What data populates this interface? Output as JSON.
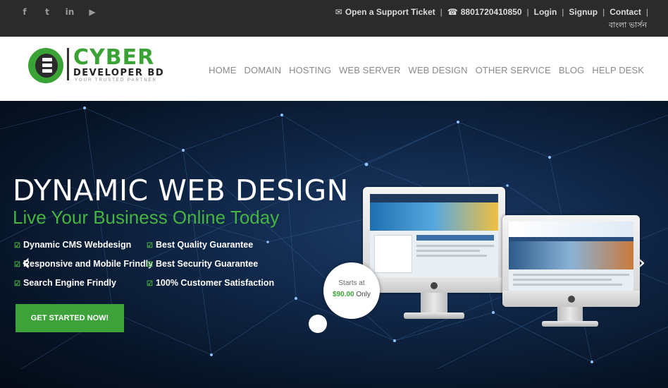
{
  "topbar": {
    "social": [
      {
        "icon": "facebook-icon",
        "glyph": "f"
      },
      {
        "icon": "twitter-icon",
        "glyph": "t"
      },
      {
        "icon": "linkedin-icon",
        "glyph": "in"
      },
      {
        "icon": "youtube-icon",
        "glyph": "▶"
      }
    ],
    "support_label": "Open a Support Ticket",
    "phone": "8801720410850",
    "login": "Login",
    "signup": "Signup",
    "contact": "Contact",
    "language": "বাংলা ভার্সন"
  },
  "logo": {
    "title": "CYBER",
    "subtitle": "DEVELOPER BD",
    "tagline": "YOUR TRUSTED PARTNER"
  },
  "nav": [
    "HOME",
    "DOMAIN",
    "HOSTING",
    "WEB SERVER",
    "WEB DESIGN",
    "OTHER SERVICE",
    "BLOG",
    "HELP DESK"
  ],
  "hero": {
    "title": "DYNAMIC WEB DESIGN",
    "subtitle": "Live Your Business Online Today",
    "features_left": [
      "Dynamic CMS Webdesign",
      "Responsive and Mobile Frindly",
      "Search Engine Frindly"
    ],
    "features_right": [
      "Best Quality Guarantee",
      "Best Security Guarantee",
      "100% Customer Satisfaction"
    ],
    "cta": "GET STARTED NOW!",
    "price_prefix": "Starts at",
    "price": "$90.00",
    "price_suffix": "Only",
    "prev_arrow": "‹",
    "next_arrow": "›"
  },
  "colors": {
    "brand_green": "#3ea23a",
    "topbar": "#2b2b2b",
    "hero_bg": "#0a1a33"
  }
}
